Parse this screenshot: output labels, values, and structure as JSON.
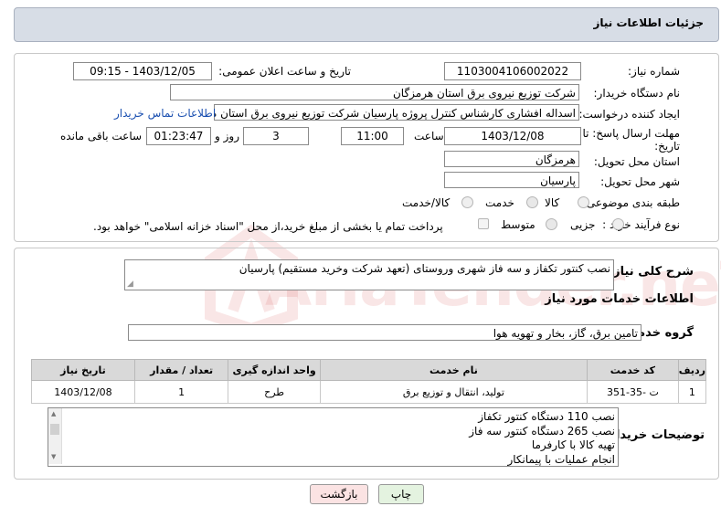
{
  "header": {
    "title": "جزئیات اطلاعات نیاز"
  },
  "form": {
    "need_number_label": "شماره نیاز:",
    "need_number": "1103004106002022",
    "announce_label": "تاریخ و ساعت اعلان عمومی:",
    "announce_value": "1403/12/05 - 09:15",
    "buyer_label": "نام دستگاه خریدار:",
    "buyer_value": "شرکت توزیع نیروی برق استان هرمزگان",
    "creator_label": "ایجاد کننده درخواست:",
    "creator_value": "اسداله افشاری کارشناس کنترل پروژه پارسیان شرکت توزیع نیروی برق استان ه",
    "contact_link": "اطلاعات تماس خریدار",
    "deadline_label_line1": "مهلت ارسال پاسخ: تا",
    "deadline_label_line2": "تاریخ:",
    "deadline_date": "1403/12/08",
    "time_label": "ساعت",
    "deadline_time": "11:00",
    "days_value": "3",
    "days_label": "روز و",
    "remaining_value": "01:23:47",
    "remaining_label": "ساعت باقی مانده",
    "province_label": "استان محل تحویل:",
    "province_value": "هرمزگان",
    "city_label": "شهر محل تحویل:",
    "city_value": "پارسیان",
    "category_label": "طبقه بندی موضوعی:",
    "category_options": [
      "کالا",
      "خدمت",
      "کالا/خدمت"
    ],
    "category_selected": "خدمت",
    "process_label": "نوع فرآیند خرید :",
    "process_options": [
      "جزیی",
      "متوسط"
    ],
    "process_selected": "متوسط",
    "payment_note": "پرداخت تمام یا بخشی از مبلغ خرید،از محل \"اسناد خزانه اسلامی\" خواهد بود."
  },
  "summary": {
    "label": "شرح کلی نیاز:",
    "value": "نصب کنتور تکفاز و سه فاز شهری وروستای (تعهد شرکت وخرید مستقیم) پارسیان"
  },
  "services": {
    "section_title": "اطلاعات خدمات مورد نیاز",
    "group_label": "گروه خدمت:",
    "group_value": "تامین برق، گاز، بخار و تهویه هوا",
    "columns": [
      "ردیف",
      "کد خدمت",
      "نام خدمت",
      "واحد اندازه گیری",
      "تعداد / مقدار",
      "تاریخ نیاز"
    ],
    "rows": [
      [
        "1",
        "ت -35-351",
        "تولید، انتقال و توزیع برق",
        "طرح",
        "1",
        "1403/12/08"
      ]
    ]
  },
  "buyer_notes": {
    "label": "توضیحات خریدار:",
    "lines": [
      "نصب 110 دستگاه  کنتور تکفاز",
      "نصب 265 دستگاه کنتور سه فاز",
      "تهیه کالا با کارفرما",
      "انجام عملیات با پیمانکار"
    ]
  },
  "buttons": {
    "print": "چاپ",
    "back": "بازگشت"
  },
  "watermark": {
    "text": "AriaTender.neT"
  },
  "colors": {
    "header_bg": "#d7dde6",
    "link": "#1a4fb0",
    "back_button_bg": "#fbe3e3",
    "print_button_bg": "#e4f3e0"
  }
}
